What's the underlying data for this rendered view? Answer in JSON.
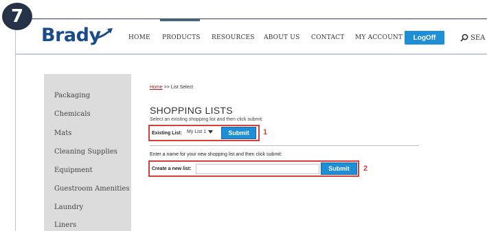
{
  "step_badge": "7",
  "header": {
    "logo_text": "Brady",
    "nav": [
      "HOME",
      "PRODUCTS",
      "RESOURCES",
      "ABOUT US",
      "CONTACT",
      "MY ACCOUNT"
    ],
    "logoff_label": "LogOff",
    "search_label": "SEA"
  },
  "sidebar": {
    "items": [
      "Packaging",
      "Chemicals",
      "Mats",
      "Cleaning Supplies",
      "Equipment",
      "Guestroom Amenities",
      "Laundry",
      "Liners"
    ]
  },
  "content": {
    "breadcrumb_home": "Home",
    "breadcrumb_rest": " >> List Select",
    "title": "SHOPPING LISTS",
    "instruction_existing": "Select an existing shopping list and then click submit.",
    "existing_label": "Existing List:",
    "existing_value": "My List 1",
    "submit_label": "Submit",
    "callout_1": "1",
    "instruction_new": "Enter a name for your new shopping list and then click submit:",
    "create_label": "Create a new list:",
    "create_value": "",
    "create_submit_label": "Submit",
    "callout_2": "2"
  },
  "colors": {
    "accent": "#1e8fd6",
    "highlight": "#d93a3a",
    "badge": "#253248"
  }
}
